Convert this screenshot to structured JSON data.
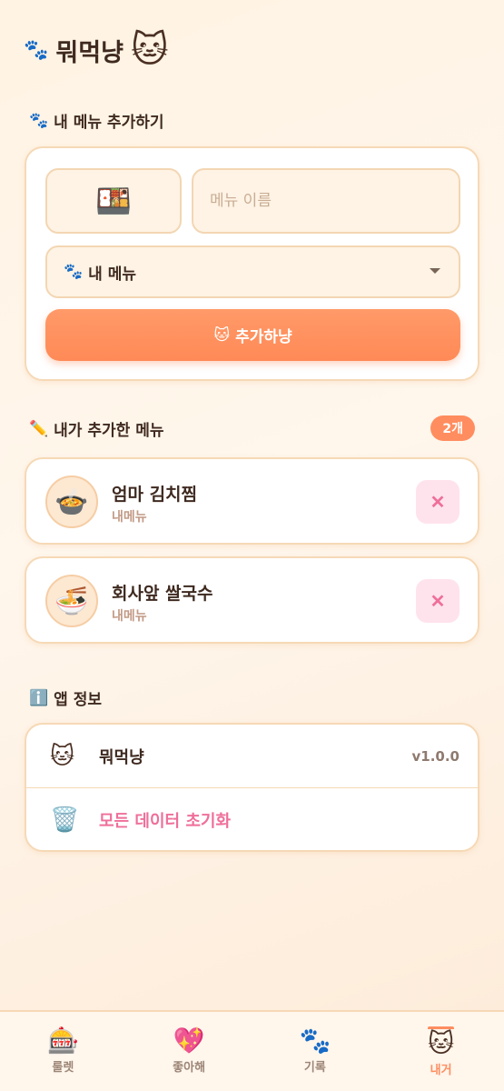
{
  "header": {
    "paw_icon": "🐾",
    "title": "뭐먹냥",
    "cat_icon": "🐱"
  },
  "add_section": {
    "icon": "🐾",
    "title": "내 메뉴 추가하기",
    "emoji_value": "🍱",
    "name_placeholder": "메뉴 이름",
    "name_value": "",
    "category_icon": "🐾",
    "category_selected": "내 메뉴",
    "add_button_icon": "🐱",
    "add_button_label": "추가하냥"
  },
  "my_menus": {
    "icon": "✏️",
    "title": "내가 추가한 메뉴",
    "count_badge": "2개",
    "items": [
      {
        "emoji": "🍲",
        "name": "엄마 김치찜",
        "tag": "내메뉴",
        "delete_label": "✕"
      },
      {
        "emoji": "🍜",
        "name": "회사앞 쌀국수",
        "tag": "내메뉴",
        "delete_label": "✕"
      }
    ]
  },
  "app_info": {
    "icon": "ℹ️",
    "title": "앱 정보",
    "app_row": {
      "icon": "🐱",
      "label": "뭐먹냥",
      "version": "v1.0.0"
    },
    "reset_row": {
      "icon": "🗑️",
      "label": "모든 데이터 초기화"
    }
  },
  "bottom_nav": {
    "items": [
      {
        "icon": "🎰",
        "label": "룰렛",
        "active": false
      },
      {
        "icon": "💖",
        "label": "좋아해",
        "active": false
      },
      {
        "icon": "🐾",
        "label": "기록",
        "active": false
      },
      {
        "icon": "🐱",
        "label": "내거",
        "active": true
      }
    ]
  },
  "colors": {
    "accent": "#ff8d5f",
    "delete": "#ef6f9a",
    "card_border": "#f6d9b6"
  }
}
